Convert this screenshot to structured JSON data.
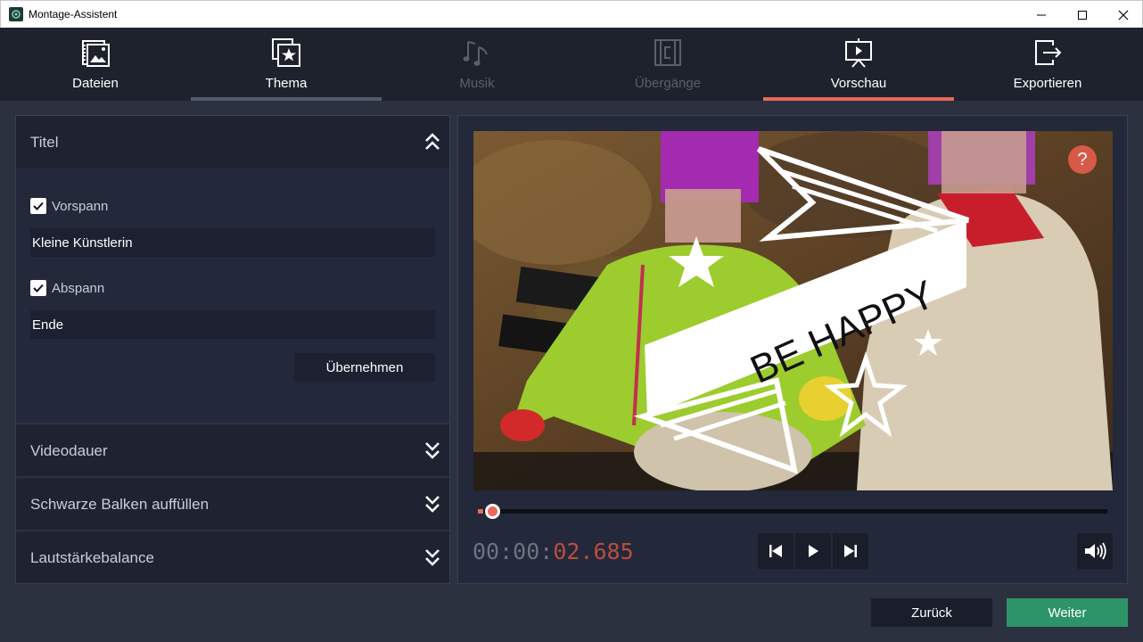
{
  "window": {
    "title": "Montage-Assistent"
  },
  "tabs": [
    {
      "label": "Dateien",
      "icon": "files-icon",
      "state": "normal"
    },
    {
      "label": "Thema",
      "icon": "theme-icon",
      "state": "visited"
    },
    {
      "label": "Musik",
      "icon": "music-icon",
      "state": "disabled"
    },
    {
      "label": "Übergänge",
      "icon": "transitions-icon",
      "state": "disabled"
    },
    {
      "label": "Vorschau",
      "icon": "preview-icon",
      "state": "active"
    },
    {
      "label": "Exportieren",
      "icon": "export-icon",
      "state": "normal"
    }
  ],
  "left_panel": {
    "sections": [
      {
        "label": "Titel",
        "expanded": true
      },
      {
        "label": "Videodauer",
        "expanded": false
      },
      {
        "label": "Schwarze Balken auffüllen",
        "expanded": false
      },
      {
        "label": "Lautstärkebalance",
        "expanded": false
      }
    ],
    "title_section": {
      "intro": {
        "label": "Vorspann",
        "checked": true,
        "value": "Kleine Künstlerin"
      },
      "outro": {
        "label": "Abspann",
        "checked": true,
        "value": "Ende"
      },
      "apply_label": "Übernehmen"
    }
  },
  "preview": {
    "overlay_text": "BE HAPPY",
    "help_label": "?",
    "progress": 0.008,
    "timecode": {
      "elapsed": "00:00:",
      "fraction": "02.685"
    }
  },
  "footer": {
    "back_label": "Zurück",
    "next_label": "Weiter"
  },
  "colors": {
    "accent": "#e9695a",
    "next_button": "#2d9468",
    "background": "#2c3140"
  }
}
